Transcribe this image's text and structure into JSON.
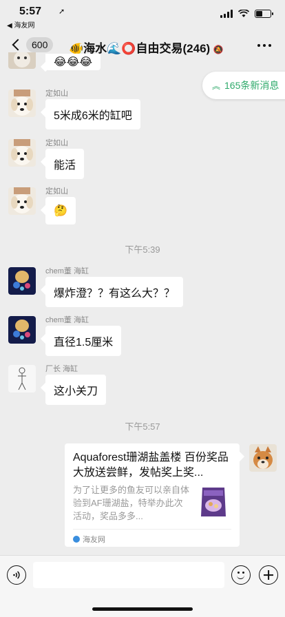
{
  "status_bar": {
    "time": "5:57",
    "location_arrow": "➚",
    "back_app": "◀ 海友网"
  },
  "nav": {
    "unread_count": "600",
    "title": "🐠海水🌊⭕自由交易(246)",
    "mute_icon": "muted-bell-icon"
  },
  "new_messages": {
    "label": "165条新消息"
  },
  "messages": [
    {
      "sender": "",
      "text": "😂😂😂"
    },
    {
      "sender": "定如山",
      "text": "5米成6米的缸吧"
    },
    {
      "sender": "定如山",
      "text": "能活"
    },
    {
      "sender": "定如山",
      "text": "🤔"
    },
    {
      "time": "下午5:39"
    },
    {
      "sender": "chem董 海缸",
      "text": "爆炸澄？？有这么大？？"
    },
    {
      "sender": "chem董 海缸",
      "text": "直径1.5厘米"
    },
    {
      "sender": "厂长 海缸",
      "text": "这小关刀"
    },
    {
      "time": "下午5:57"
    }
  ],
  "link_card": {
    "title": "Aquaforest珊湖盐盖楼 百份奖品大放送尝鲜，发帖奖上奖...",
    "description": "为了让更多的鱼友可以亲自体验到AF珊湖盐，特举办此次活动，奖品多多...",
    "source": "海友网"
  },
  "colors": {
    "accent_green": "#2faa6b",
    "background": "#ededed"
  }
}
